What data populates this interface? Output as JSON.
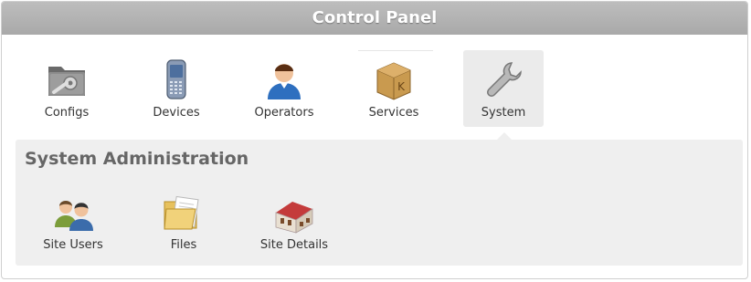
{
  "header": {
    "title": "Control Panel"
  },
  "tools": [
    {
      "label": "Configs",
      "icon": "folder-settings-icon"
    },
    {
      "label": "Devices",
      "icon": "mobile-device-icon"
    },
    {
      "label": "Operators",
      "icon": "operator-user-icon"
    },
    {
      "label": "Services",
      "icon": "package-box-icon"
    },
    {
      "label": "System",
      "icon": "wrench-icon",
      "active": true
    }
  ],
  "system_admin": {
    "title": "System Administration",
    "items": [
      {
        "label": "Site Users",
        "icon": "users-icon"
      },
      {
        "label": "Files",
        "icon": "files-folder-icon"
      },
      {
        "label": "Site Details",
        "icon": "building-icon"
      }
    ]
  }
}
